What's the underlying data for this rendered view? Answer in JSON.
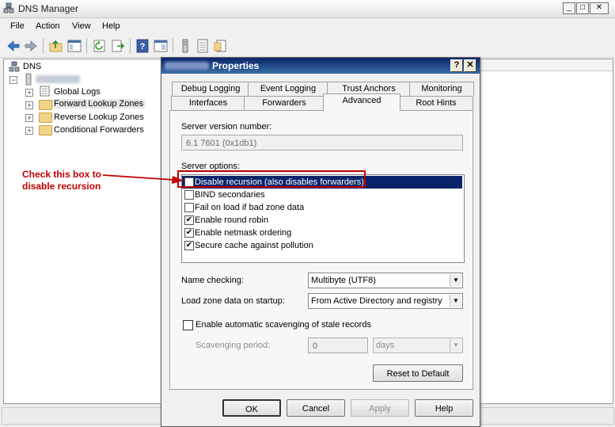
{
  "app": {
    "title": "DNS Manager",
    "win_min": "_",
    "win_max": "□",
    "win_close": "✕"
  },
  "menu": [
    "File",
    "Action",
    "View",
    "Help"
  ],
  "tree": {
    "root": "DNS",
    "items": [
      "Global Logs",
      "Forward Lookup Zones",
      "Reverse Lookup Zones",
      "Conditional Forwarders"
    ]
  },
  "dialog": {
    "title": "Properties",
    "help_btn": "?",
    "close_btn": "✕",
    "tabs_back": [
      "Debug Logging",
      "Event Logging",
      "Trust Anchors",
      "Monitoring"
    ],
    "tabs_front": [
      "Interfaces",
      "Forwarders",
      "Advanced",
      "Root Hints"
    ],
    "active_tab": "Advanced",
    "version_label": "Server version number:",
    "version_value": "6.1 7601 (0x1db1)",
    "options_label": "Server options:",
    "options": [
      {
        "label": "Disable recursion (also disables forwarders)",
        "checked": false,
        "selected": true
      },
      {
        "label": "BIND secondaries",
        "checked": false,
        "selected": false
      },
      {
        "label": "Fail on load if bad zone data",
        "checked": false,
        "selected": false
      },
      {
        "label": "Enable round robin",
        "checked": true,
        "selected": false
      },
      {
        "label": "Enable netmask ordering",
        "checked": true,
        "selected": false
      },
      {
        "label": "Secure cache against pollution",
        "checked": true,
        "selected": false
      }
    ],
    "name_checking_label": "Name checking:",
    "name_checking_value": "Multibyte (UTF8)",
    "load_zone_label": "Load zone data on startup:",
    "load_zone_value": "From Active Directory and registry",
    "scavenging_label": "Enable automatic scavenging of stale records",
    "scavenging_checked": false,
    "scavenging_period_label": "Scavenging period:",
    "scavenging_period_value": "0",
    "scavenging_unit": "days",
    "reset_btn": "Reset to Default",
    "ok_btn": "OK",
    "cancel_btn": "Cancel",
    "apply_btn": "Apply",
    "help_bottom_btn": "Help"
  },
  "annotation": {
    "line1": "Check this box to",
    "line2": "disable recursion",
    "color": "#c00000"
  },
  "colors": {
    "title_blue": "#0a246a",
    "selection": "#0a246a"
  }
}
